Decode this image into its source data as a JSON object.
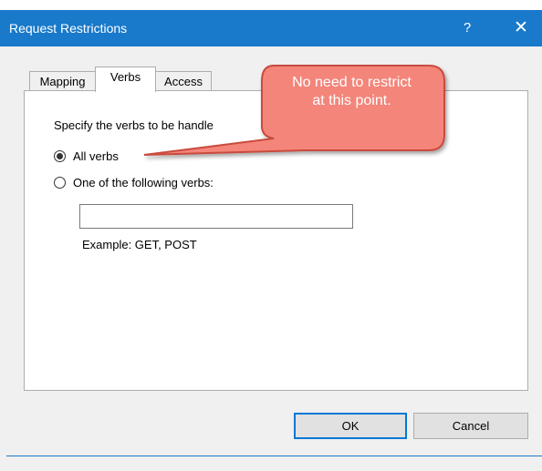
{
  "window": {
    "title": "Request Restrictions",
    "help_label": "?",
    "close_label": "✕"
  },
  "tabs": [
    {
      "label": "Mapping",
      "active": false
    },
    {
      "label": "Verbs",
      "active": true
    },
    {
      "label": "Access",
      "active": false
    }
  ],
  "verbs": {
    "description": "Specify the verbs to be handle",
    "all_verbs_label": "All verbs",
    "all_verbs_selected": true,
    "one_of_label": "One of the following verbs:",
    "one_of_selected": false,
    "input_value": "",
    "example": "Example: GET, POST"
  },
  "buttons": {
    "ok": "OK",
    "cancel": "Cancel"
  },
  "callout": {
    "text_line1": "No need to restrict",
    "text_line2": "at this point.",
    "color": "#f4857a"
  }
}
